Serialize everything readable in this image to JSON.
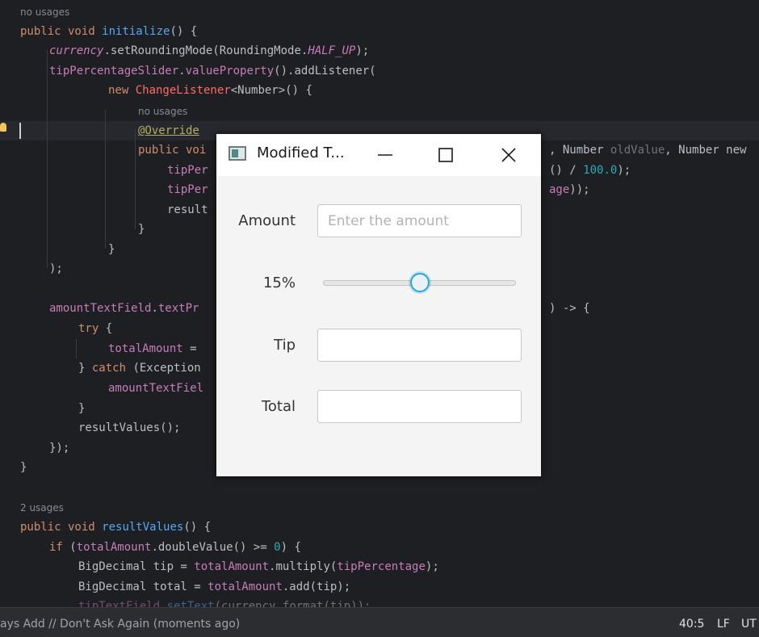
{
  "editor": {
    "hints": {
      "no_usages_1": "no usages",
      "no_usages_2": "no usages",
      "two_usages": "2 usages"
    }
  },
  "dialog": {
    "title": "Modified T...",
    "amount_label": "Amount",
    "amount_placeholder": "Enter the amount",
    "amount_value": "",
    "percent_label": "15%",
    "slider_value_percent": 0.5,
    "tip_label": "Tip",
    "tip_value": "",
    "total_label": "Total",
    "total_value": ""
  },
  "statusbar": {
    "left_text": "ays Add // Don't Ask Again (moments ago)",
    "position": "40:5",
    "line_sep": "LF",
    "encoding": "UT"
  }
}
